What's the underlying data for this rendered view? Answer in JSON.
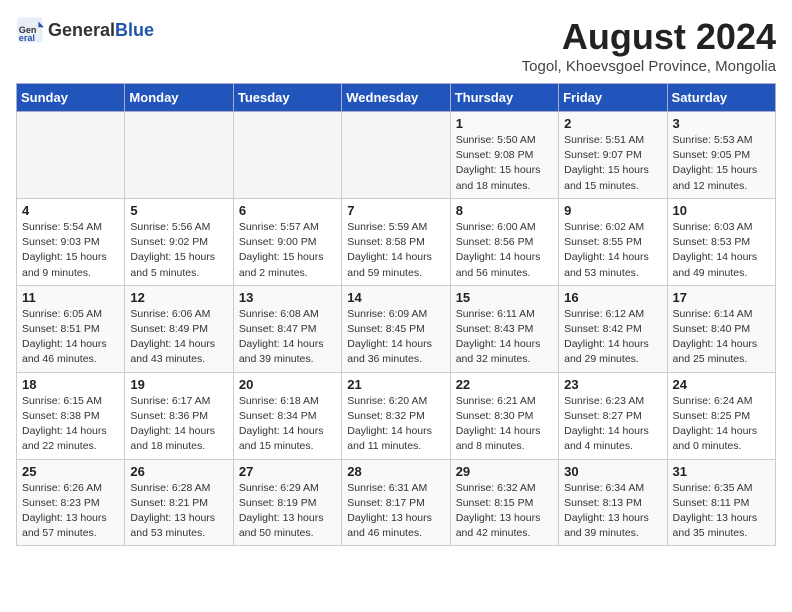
{
  "header": {
    "logo_general": "General",
    "logo_blue": "Blue",
    "month_year": "August 2024",
    "location": "Togol, Khoevsgoel Province, Mongolia"
  },
  "weekdays": [
    "Sunday",
    "Monday",
    "Tuesday",
    "Wednesday",
    "Thursday",
    "Friday",
    "Saturday"
  ],
  "weeks": [
    [
      {
        "day": "",
        "info": ""
      },
      {
        "day": "",
        "info": ""
      },
      {
        "day": "",
        "info": ""
      },
      {
        "day": "",
        "info": ""
      },
      {
        "day": "1",
        "info": "Sunrise: 5:50 AM\nSunset: 9:08 PM\nDaylight: 15 hours\nand 18 minutes."
      },
      {
        "day": "2",
        "info": "Sunrise: 5:51 AM\nSunset: 9:07 PM\nDaylight: 15 hours\nand 15 minutes."
      },
      {
        "day": "3",
        "info": "Sunrise: 5:53 AM\nSunset: 9:05 PM\nDaylight: 15 hours\nand 12 minutes."
      }
    ],
    [
      {
        "day": "4",
        "info": "Sunrise: 5:54 AM\nSunset: 9:03 PM\nDaylight: 15 hours\nand 9 minutes."
      },
      {
        "day": "5",
        "info": "Sunrise: 5:56 AM\nSunset: 9:02 PM\nDaylight: 15 hours\nand 5 minutes."
      },
      {
        "day": "6",
        "info": "Sunrise: 5:57 AM\nSunset: 9:00 PM\nDaylight: 15 hours\nand 2 minutes."
      },
      {
        "day": "7",
        "info": "Sunrise: 5:59 AM\nSunset: 8:58 PM\nDaylight: 14 hours\nand 59 minutes."
      },
      {
        "day": "8",
        "info": "Sunrise: 6:00 AM\nSunset: 8:56 PM\nDaylight: 14 hours\nand 56 minutes."
      },
      {
        "day": "9",
        "info": "Sunrise: 6:02 AM\nSunset: 8:55 PM\nDaylight: 14 hours\nand 53 minutes."
      },
      {
        "day": "10",
        "info": "Sunrise: 6:03 AM\nSunset: 8:53 PM\nDaylight: 14 hours\nand 49 minutes."
      }
    ],
    [
      {
        "day": "11",
        "info": "Sunrise: 6:05 AM\nSunset: 8:51 PM\nDaylight: 14 hours\nand 46 minutes."
      },
      {
        "day": "12",
        "info": "Sunrise: 6:06 AM\nSunset: 8:49 PM\nDaylight: 14 hours\nand 43 minutes."
      },
      {
        "day": "13",
        "info": "Sunrise: 6:08 AM\nSunset: 8:47 PM\nDaylight: 14 hours\nand 39 minutes."
      },
      {
        "day": "14",
        "info": "Sunrise: 6:09 AM\nSunset: 8:45 PM\nDaylight: 14 hours\nand 36 minutes."
      },
      {
        "day": "15",
        "info": "Sunrise: 6:11 AM\nSunset: 8:43 PM\nDaylight: 14 hours\nand 32 minutes."
      },
      {
        "day": "16",
        "info": "Sunrise: 6:12 AM\nSunset: 8:42 PM\nDaylight: 14 hours\nand 29 minutes."
      },
      {
        "day": "17",
        "info": "Sunrise: 6:14 AM\nSunset: 8:40 PM\nDaylight: 14 hours\nand 25 minutes."
      }
    ],
    [
      {
        "day": "18",
        "info": "Sunrise: 6:15 AM\nSunset: 8:38 PM\nDaylight: 14 hours\nand 22 minutes."
      },
      {
        "day": "19",
        "info": "Sunrise: 6:17 AM\nSunset: 8:36 PM\nDaylight: 14 hours\nand 18 minutes."
      },
      {
        "day": "20",
        "info": "Sunrise: 6:18 AM\nSunset: 8:34 PM\nDaylight: 14 hours\nand 15 minutes."
      },
      {
        "day": "21",
        "info": "Sunrise: 6:20 AM\nSunset: 8:32 PM\nDaylight: 14 hours\nand 11 minutes."
      },
      {
        "day": "22",
        "info": "Sunrise: 6:21 AM\nSunset: 8:30 PM\nDaylight: 14 hours\nand 8 minutes."
      },
      {
        "day": "23",
        "info": "Sunrise: 6:23 AM\nSunset: 8:27 PM\nDaylight: 14 hours\nand 4 minutes."
      },
      {
        "day": "24",
        "info": "Sunrise: 6:24 AM\nSunset: 8:25 PM\nDaylight: 14 hours\nand 0 minutes."
      }
    ],
    [
      {
        "day": "25",
        "info": "Sunrise: 6:26 AM\nSunset: 8:23 PM\nDaylight: 13 hours\nand 57 minutes."
      },
      {
        "day": "26",
        "info": "Sunrise: 6:28 AM\nSunset: 8:21 PM\nDaylight: 13 hours\nand 53 minutes."
      },
      {
        "day": "27",
        "info": "Sunrise: 6:29 AM\nSunset: 8:19 PM\nDaylight: 13 hours\nand 50 minutes."
      },
      {
        "day": "28",
        "info": "Sunrise: 6:31 AM\nSunset: 8:17 PM\nDaylight: 13 hours\nand 46 minutes."
      },
      {
        "day": "29",
        "info": "Sunrise: 6:32 AM\nSunset: 8:15 PM\nDaylight: 13 hours\nand 42 minutes."
      },
      {
        "day": "30",
        "info": "Sunrise: 6:34 AM\nSunset: 8:13 PM\nDaylight: 13 hours\nand 39 minutes."
      },
      {
        "day": "31",
        "info": "Sunrise: 6:35 AM\nSunset: 8:11 PM\nDaylight: 13 hours\nand 35 minutes."
      }
    ]
  ]
}
